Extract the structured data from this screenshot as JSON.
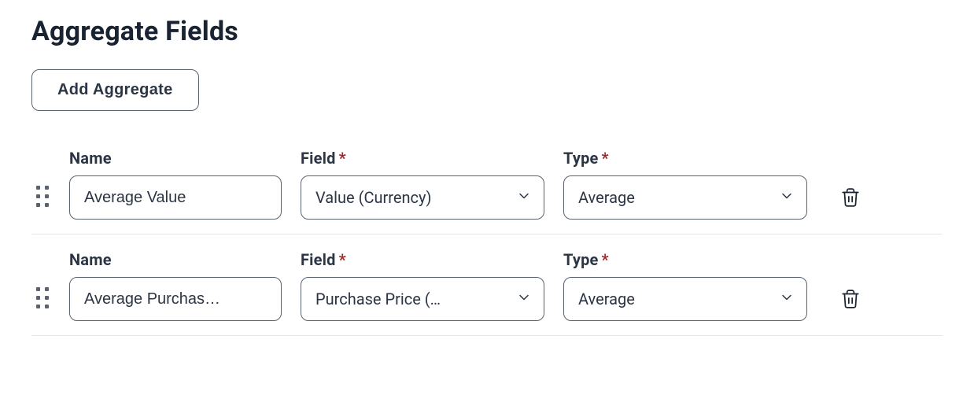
{
  "section": {
    "title": "Aggregate Fields",
    "add_button_label": "Add Aggregate"
  },
  "labels": {
    "name": "Name",
    "field": "Field",
    "type": "Type",
    "required_marker": "*"
  },
  "rows": [
    {
      "name_value": "Average Value",
      "field_value": "Value (Currency)",
      "type_value": "Average"
    },
    {
      "name_value": "Average Purchas…",
      "field_value": "Purchase Price (…",
      "type_value": "Average"
    }
  ]
}
